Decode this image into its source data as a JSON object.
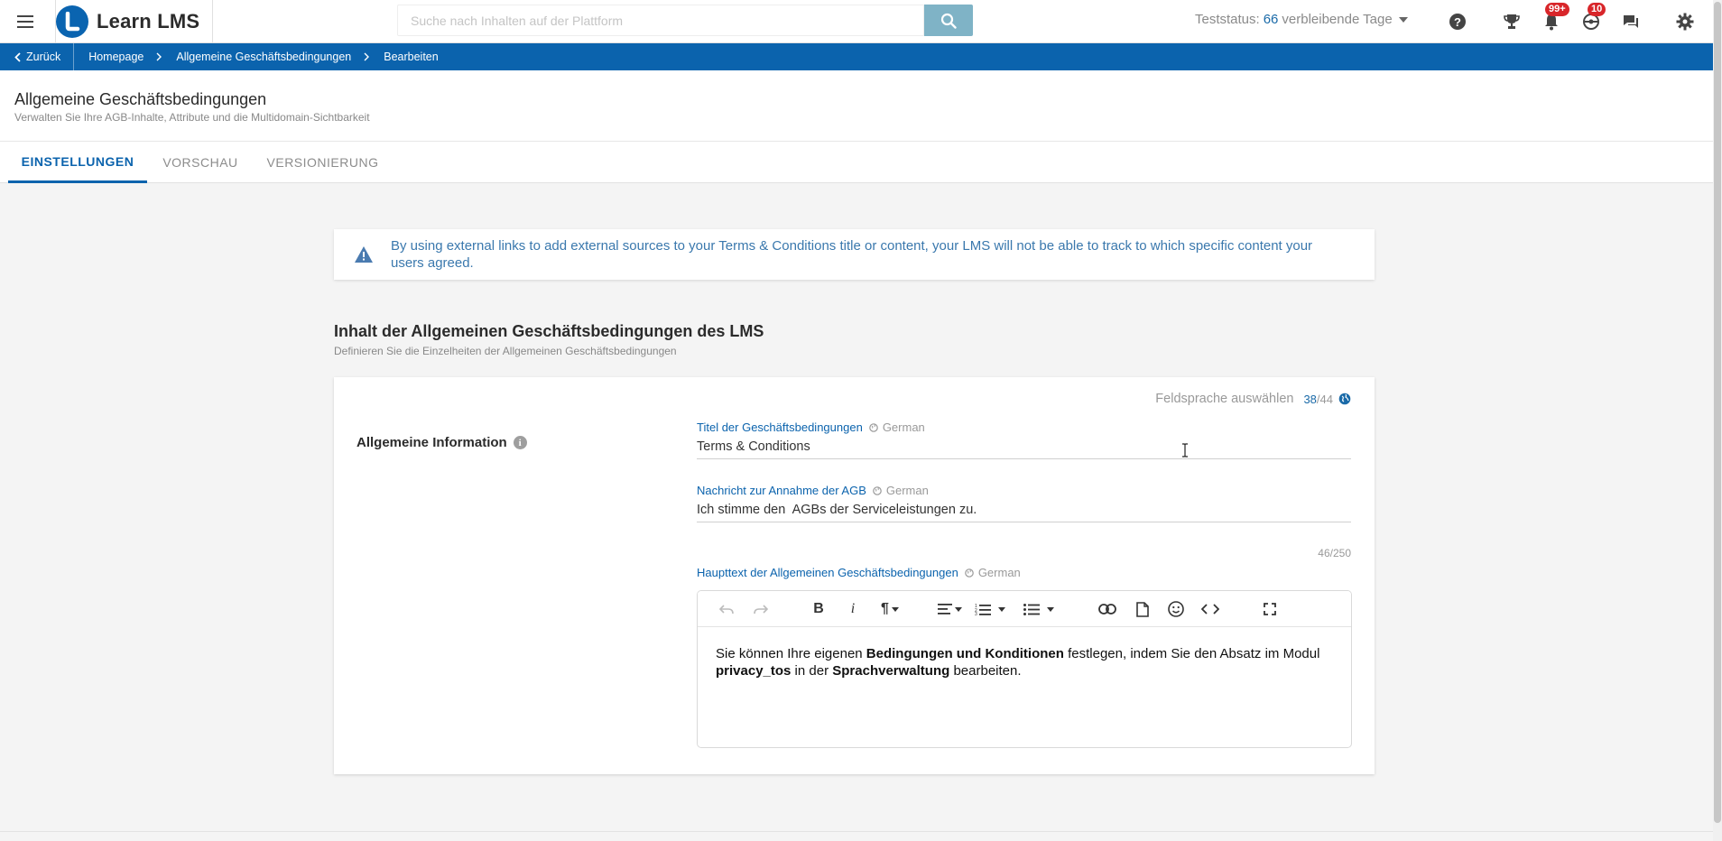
{
  "header": {
    "brand": "Learn LMS",
    "search_placeholder": "Suche nach Inhalten auf der Plattform",
    "trial_prefix": "Teststatus:",
    "trial_days": "66",
    "trial_suffix": "verbleibende Tage",
    "notifications_badge": "99+",
    "messages_badge": "10"
  },
  "breadcrumb": {
    "back": "Zurück",
    "items": [
      "Homepage",
      "Allgemeine Geschäftsbedingungen",
      "Bearbeiten"
    ]
  },
  "page": {
    "title": "Allgemeine Geschäftsbedingungen",
    "subtitle": "Verwalten Sie Ihre AGB-Inhalte, Attribute und die Multidomain-Sichtbarkeit"
  },
  "tabs": [
    "EINSTELLUNGEN",
    "VORSCHAU",
    "VERSIONIERUNG"
  ],
  "warning": {
    "text": "By using external links to add external sources to your Terms & Conditions title or content, your LMS will not be able to track to which specific content your users agreed."
  },
  "section": {
    "title": "Inhalt der Allgemeinen Geschäftsbedingungen des LMS",
    "subtitle": "Definieren Sie die Einzelheiten der Allgemeinen Geschäftsbedingungen"
  },
  "card": {
    "language_picker_label": "Feldsprache auswählen",
    "language_count": "38",
    "language_total": "/44",
    "group_label": "Allgemeine Information",
    "fields": {
      "title": {
        "label": "Titel der Geschäftsbedingungen",
        "lang": "German",
        "value": "Terms & Conditions"
      },
      "message": {
        "label": "Nachricht zur Annahme der AGB",
        "lang": "German",
        "value": "Ich stimme den  AGBs der Serviceleistungen zu.",
        "counter": "46/250"
      },
      "body": {
        "label": "Haupttext der Allgemeinen Geschäftsbedingungen",
        "lang": "German"
      }
    },
    "editor_text": {
      "p1": "Sie können Ihre eigenen ",
      "b1": "Bedingungen und Konditionen",
      "p2": " festlegen, indem Sie den Absatz im Modul ",
      "b2": "privacy_tos",
      "p3": " in der ",
      "b3": "Sprachverwaltung",
      "p4": " bearbeiten."
    }
  },
  "colors": {
    "brand_blue": "#0b63ad",
    "search_button": "#7fb3c6",
    "badge_red": "#d8262a"
  }
}
